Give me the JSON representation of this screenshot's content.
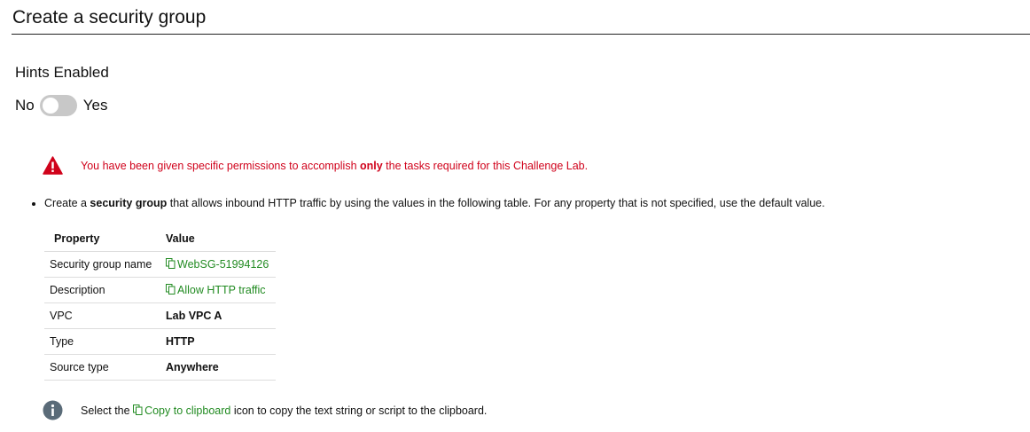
{
  "header": {
    "title": "Create a security group"
  },
  "hints": {
    "label": "Hints Enabled",
    "no_label": "No",
    "yes_label": "Yes",
    "enabled": false
  },
  "warning": {
    "icon": "warning-triangle-icon",
    "text_before": "You have been given specific permissions to accomplish ",
    "text_bold": "only",
    "text_after": " the tasks required for this Challenge Lab.",
    "color": "#d0021b"
  },
  "task": {
    "text_before": "Create a ",
    "text_bold": "security group",
    "text_after": " that allows inbound HTTP traffic by using the values in the following table. For any property that is not specified, use the default value."
  },
  "table": {
    "headers": [
      "Property",
      "Value"
    ],
    "rows": [
      {
        "property": "Security group name",
        "value": "WebSG-51994126"
      },
      {
        "property": "Description",
        "value": "Allow HTTP traffic"
      },
      {
        "property": "VPC",
        "value": "Lab VPC A"
      },
      {
        "property": "Type",
        "value": "HTTP"
      },
      {
        "property": "Source type",
        "value": "Anywhere"
      }
    ]
  },
  "info": {
    "icon": "info-circle-icon",
    "text_before": "Select the ",
    "link_text": "Copy to clipboard",
    "text_after": " icon to copy the text string or script to the clipboard."
  },
  "colors": {
    "copy_link": "#228b22",
    "toggle_off": "#c8c8c8",
    "info_icon": "#5a6b78"
  }
}
